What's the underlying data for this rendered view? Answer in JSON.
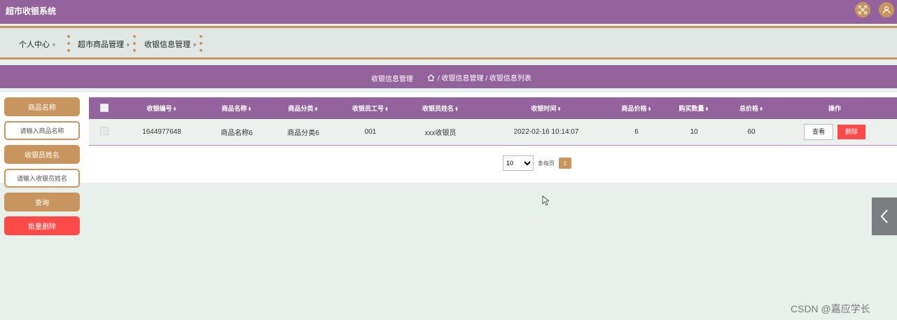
{
  "app": {
    "title": "超市收银系统"
  },
  "nav": {
    "items": [
      {
        "label": "个人中心"
      },
      {
        "label": "超市商品管理"
      },
      {
        "label": "收银信息管理"
      }
    ]
  },
  "breadcrumb": {
    "section": "收银信息管理",
    "path": "/ 收银信息管理 / 收银信息列表"
  },
  "search": {
    "product_label": "商品名称",
    "product_placeholder": "请输入商品名称",
    "cashier_label": "收银员姓名",
    "cashier_placeholder": "请输入收银员姓名",
    "query_label": "查询",
    "batch_delete_label": "批量删除"
  },
  "table": {
    "columns": [
      "收银编号",
      "商品名称",
      "商品分类",
      "收银员工号",
      "收银员姓名",
      "收银时间",
      "商品价格",
      "购买数量",
      "总价格",
      "操作"
    ],
    "rows": [
      {
        "id": "1644977648",
        "name": "商品名称6",
        "category": "商品分类6",
        "cashier_no": "001",
        "cashier_name": "xxx收银员",
        "time": "2022-02-16 10:14:07",
        "price": "6",
        "qty": "10",
        "total": "60",
        "view_label": "查看",
        "delete_label": "删除"
      }
    ]
  },
  "pagination": {
    "page_size": "10",
    "page_size_label": "条每页",
    "current_page": "1"
  },
  "watermark": "CSDN @嘉应学长",
  "colors": {
    "primary": "#94629c",
    "accent": "#c9955f",
    "danger": "#ff4a4a",
    "background": "#e8f0ec"
  },
  "icons": {
    "fullscreen": "fullscreen-icon",
    "user": "user-icon",
    "home": "home-icon",
    "collapse": "chevron-left-icon"
  }
}
